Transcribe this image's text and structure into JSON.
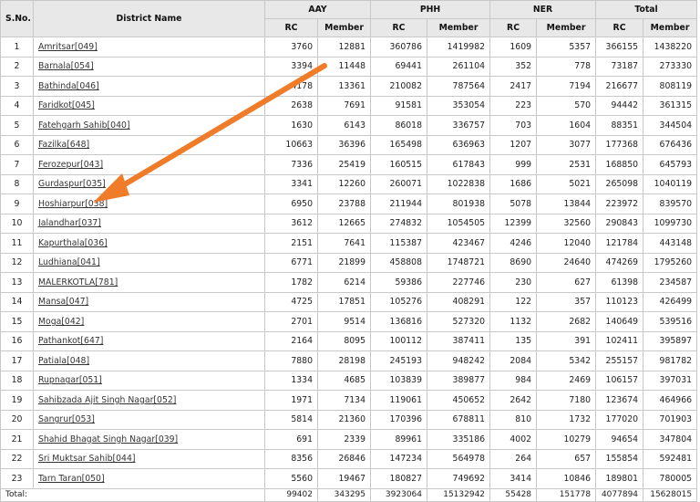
{
  "headers": {
    "sno": "S.No.",
    "district": "District Name",
    "groups": [
      "AAY",
      "PHH",
      "NER",
      "Total"
    ],
    "rc": "RC",
    "member": "Member"
  },
  "rows": [
    {
      "sno": "1",
      "name": "Amritsar[049]",
      "aay_rc": "3760",
      "aay_m": "12881",
      "phh_rc": "360786",
      "phh_m": "1419982",
      "ner_rc": "1609",
      "ner_m": "5357",
      "tot_rc": "366155",
      "tot_m": "1438220"
    },
    {
      "sno": "2",
      "name": "Barnala[054]",
      "aay_rc": "3394",
      "aay_m": "11448",
      "phh_rc": "69441",
      "phh_m": "261104",
      "ner_rc": "352",
      "ner_m": "778",
      "tot_rc": "73187",
      "tot_m": "273330"
    },
    {
      "sno": "3",
      "name": "Bathinda[046]",
      "aay_rc": "4178",
      "aay_m": "13361",
      "phh_rc": "210082",
      "phh_m": "787564",
      "ner_rc": "2417",
      "ner_m": "7194",
      "tot_rc": "216677",
      "tot_m": "808119"
    },
    {
      "sno": "4",
      "name": "Faridkot[045]",
      "aay_rc": "2638",
      "aay_m": "7691",
      "phh_rc": "91581",
      "phh_m": "353054",
      "ner_rc": "223",
      "ner_m": "570",
      "tot_rc": "94442",
      "tot_m": "361315"
    },
    {
      "sno": "5",
      "name": "Fatehgarh Sahib[040]",
      "aay_rc": "1630",
      "aay_m": "6143",
      "phh_rc": "86018",
      "phh_m": "336757",
      "ner_rc": "703",
      "ner_m": "1604",
      "tot_rc": "88351",
      "tot_m": "344504"
    },
    {
      "sno": "6",
      "name": "Fazilka[648]",
      "aay_rc": "10663",
      "aay_m": "36396",
      "phh_rc": "165498",
      "phh_m": "636963",
      "ner_rc": "1207",
      "ner_m": "3077",
      "tot_rc": "177368",
      "tot_m": "676436"
    },
    {
      "sno": "7",
      "name": "Ferozepur[043]",
      "aay_rc": "7336",
      "aay_m": "25419",
      "phh_rc": "160515",
      "phh_m": "617843",
      "ner_rc": "999",
      "ner_m": "2531",
      "tot_rc": "168850",
      "tot_m": "645793"
    },
    {
      "sno": "8",
      "name": "Gurdaspur[035]",
      "aay_rc": "3341",
      "aay_m": "12260",
      "phh_rc": "260071",
      "phh_m": "1022838",
      "ner_rc": "1686",
      "ner_m": "5021",
      "tot_rc": "265098",
      "tot_m": "1040119"
    },
    {
      "sno": "9",
      "name": "Hoshiarpur[038]",
      "aay_rc": "6950",
      "aay_m": "23788",
      "phh_rc": "211944",
      "phh_m": "801938",
      "ner_rc": "5078",
      "ner_m": "13844",
      "tot_rc": "223972",
      "tot_m": "839570"
    },
    {
      "sno": "10",
      "name": "Jalandhar[037]",
      "aay_rc": "3612",
      "aay_m": "12665",
      "phh_rc": "274832",
      "phh_m": "1054505",
      "ner_rc": "12399",
      "ner_m": "32560",
      "tot_rc": "290843",
      "tot_m": "1099730"
    },
    {
      "sno": "11",
      "name": "Kapurthala[036]",
      "aay_rc": "2151",
      "aay_m": "7641",
      "phh_rc": "115387",
      "phh_m": "423467",
      "ner_rc": "4246",
      "ner_m": "12040",
      "tot_rc": "121784",
      "tot_m": "443148"
    },
    {
      "sno": "12",
      "name": "Ludhiana[041]",
      "aay_rc": "6771",
      "aay_m": "21899",
      "phh_rc": "458808",
      "phh_m": "1748721",
      "ner_rc": "8690",
      "ner_m": "24640",
      "tot_rc": "474269",
      "tot_m": "1795260"
    },
    {
      "sno": "13",
      "name": "MALERKOTLA[781]",
      "aay_rc": "1782",
      "aay_m": "6214",
      "phh_rc": "59386",
      "phh_m": "227746",
      "ner_rc": "230",
      "ner_m": "627",
      "tot_rc": "61398",
      "tot_m": "234587"
    },
    {
      "sno": "14",
      "name": "Mansa[047]",
      "aay_rc": "4725",
      "aay_m": "17851",
      "phh_rc": "105276",
      "phh_m": "408291",
      "ner_rc": "122",
      "ner_m": "357",
      "tot_rc": "110123",
      "tot_m": "426499"
    },
    {
      "sno": "15",
      "name": "Moga[042]",
      "aay_rc": "2701",
      "aay_m": "9514",
      "phh_rc": "136816",
      "phh_m": "527320",
      "ner_rc": "1132",
      "ner_m": "2682",
      "tot_rc": "140649",
      "tot_m": "539516"
    },
    {
      "sno": "16",
      "name": "Pathankot[647]",
      "aay_rc": "2164",
      "aay_m": "8095",
      "phh_rc": "100112",
      "phh_m": "387411",
      "ner_rc": "135",
      "ner_m": "391",
      "tot_rc": "102411",
      "tot_m": "395897"
    },
    {
      "sno": "17",
      "name": "Patiala[048]",
      "aay_rc": "7880",
      "aay_m": "28198",
      "phh_rc": "245193",
      "phh_m": "948242",
      "ner_rc": "2084",
      "ner_m": "5342",
      "tot_rc": "255157",
      "tot_m": "981782"
    },
    {
      "sno": "18",
      "name": "Rupnagar[051]",
      "aay_rc": "1334",
      "aay_m": "4685",
      "phh_rc": "103839",
      "phh_m": "389877",
      "ner_rc": "984",
      "ner_m": "2469",
      "tot_rc": "106157",
      "tot_m": "397031"
    },
    {
      "sno": "19",
      "name": "Sahibzada Ajit Singh Nagar[052]",
      "aay_rc": "1971",
      "aay_m": "7134",
      "phh_rc": "119061",
      "phh_m": "450652",
      "ner_rc": "2642",
      "ner_m": "7180",
      "tot_rc": "123674",
      "tot_m": "464966"
    },
    {
      "sno": "20",
      "name": "Sangrur[053]",
      "aay_rc": "5814",
      "aay_m": "21360",
      "phh_rc": "170396",
      "phh_m": "678811",
      "ner_rc": "810",
      "ner_m": "1732",
      "tot_rc": "177020",
      "tot_m": "701903"
    },
    {
      "sno": "21",
      "name": "Shahid Bhagat Singh Nagar[039]",
      "aay_rc": "691",
      "aay_m": "2339",
      "phh_rc": "89961",
      "phh_m": "335186",
      "ner_rc": "4002",
      "ner_m": "10279",
      "tot_rc": "94654",
      "tot_m": "347804"
    },
    {
      "sno": "22",
      "name": "Sri Muktsar Sahib[044]",
      "aay_rc": "8356",
      "aay_m": "26846",
      "phh_rc": "147234",
      "phh_m": "564978",
      "ner_rc": "264",
      "ner_m": "657",
      "tot_rc": "155854",
      "tot_m": "592481"
    },
    {
      "sno": "23",
      "name": "Tarn Taran[050]",
      "aay_rc": "5560",
      "aay_m": "19467",
      "phh_rc": "180827",
      "phh_m": "749692",
      "ner_rc": "3414",
      "ner_m": "10846",
      "tot_rc": "189801",
      "tot_m": "780005"
    }
  ],
  "totals": {
    "label": "Total:",
    "aay_rc": "99402",
    "aay_m": "343295",
    "phh_rc": "3923064",
    "phh_m": "15132942",
    "ner_rc": "55428",
    "ner_m": "151778",
    "tot_rc": "4077894",
    "tot_m": "15628015"
  },
  "annotation": {
    "arrow_color": "#f07c2a",
    "target": "Hoshiarpur[038]"
  }
}
